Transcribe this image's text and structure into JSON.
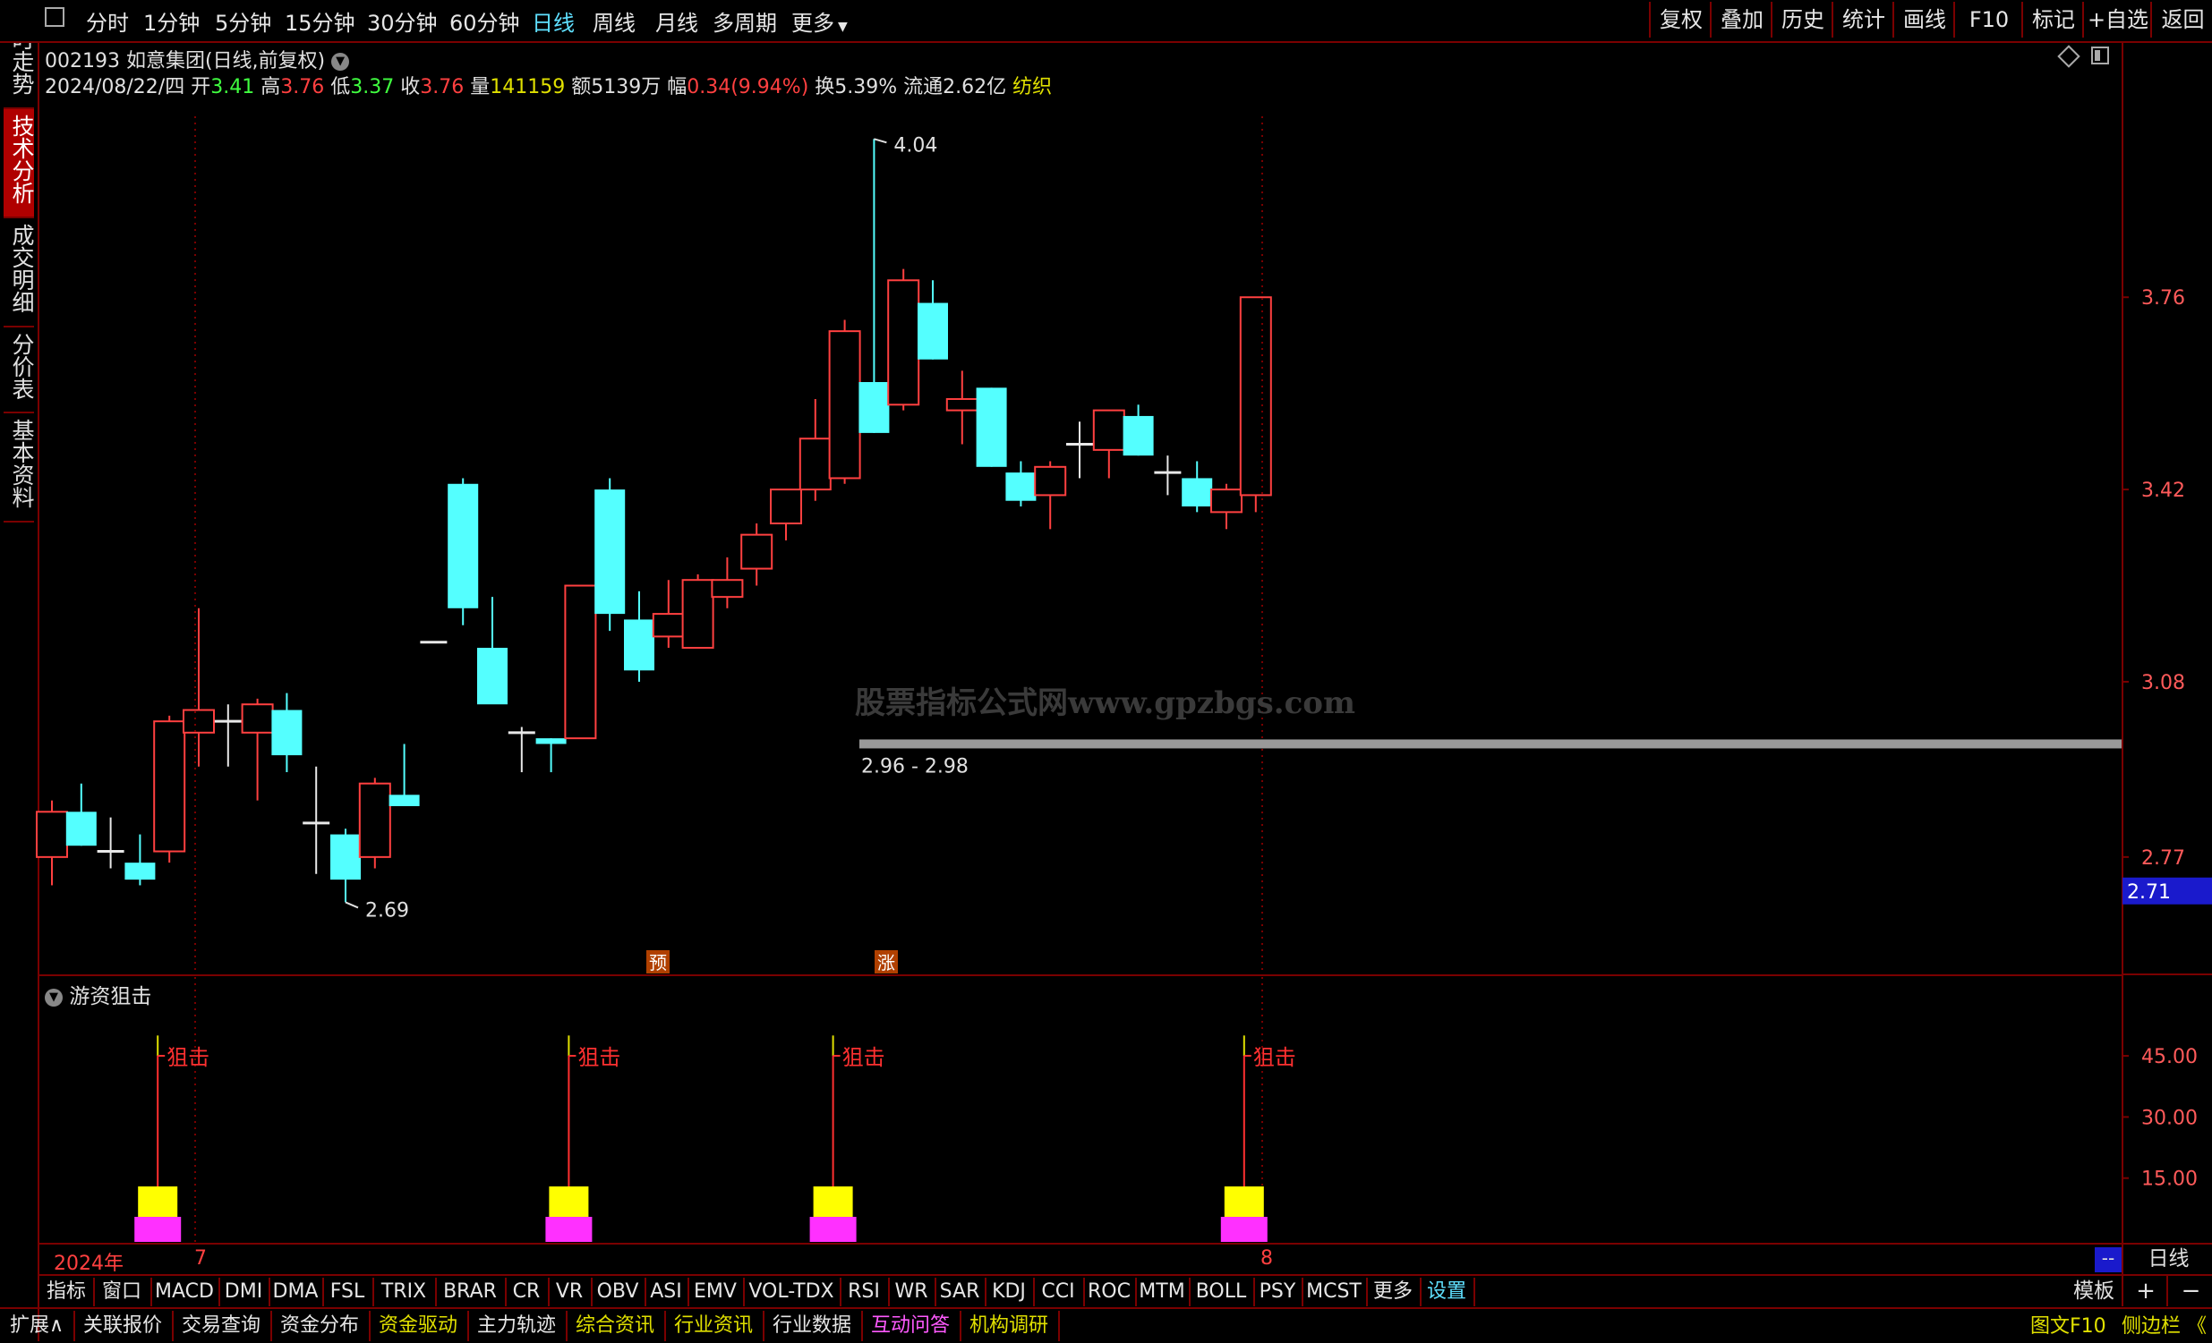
{
  "toolbar": {
    "periods": [
      "分时",
      "1分钟",
      "5分钟",
      "15分钟",
      "30分钟",
      "60分钟",
      "日线",
      "周线",
      "月线",
      "多周期",
      "更多"
    ],
    "active_period": "日线",
    "right_buttons": [
      "复权",
      "叠加",
      "历史",
      "统计",
      "画线",
      "F10",
      "标记",
      "+自选",
      "返回"
    ]
  },
  "left_tabs": [
    "分时走势",
    "技术分析",
    "成交明细",
    "分价表",
    "基本资料"
  ],
  "stock": {
    "code_name": "002193 如意集团(日线,前复权)",
    "date": "2024/08/22/四",
    "open_label": "开",
    "open": "3.41",
    "high_label": "高",
    "high": "3.76",
    "low_label": "低",
    "low": "3.37",
    "close_label": "收",
    "close": "3.76",
    "vol_label": "量",
    "vol": "141159",
    "amount": "额5139万",
    "change_label": "幅",
    "change": "0.34(9.94%)",
    "turnover": "换5.39%",
    "float": "流通2.62亿",
    "industry": "纺织"
  },
  "chart_data": [
    {
      "type": "candlestick",
      "ylim": [
        2.64,
        4.08
      ],
      "y_ticks": [
        "3.76",
        "3.42",
        "3.08",
        "2.77"
      ],
      "current_price_tag": "2.71",
      "candles": [
        {
          "o": 2.77,
          "h": 2.87,
          "l": 2.72,
          "c": 2.85
        },
        {
          "o": 2.85,
          "h": 2.9,
          "l": 2.79,
          "c": 2.79
        },
        {
          "o": 2.78,
          "h": 2.84,
          "l": 2.75,
          "c": 2.78
        },
        {
          "o": 2.76,
          "h": 2.81,
          "l": 2.72,
          "c": 2.73
        },
        {
          "o": 2.78,
          "h": 3.02,
          "l": 2.76,
          "c": 3.01
        },
        {
          "o": 2.99,
          "h": 3.21,
          "l": 2.93,
          "c": 3.03
        },
        {
          "o": 3.01,
          "h": 3.04,
          "l": 2.93,
          "c": 3.01
        },
        {
          "o": 2.99,
          "h": 3.05,
          "l": 2.87,
          "c": 3.04
        },
        {
          "o": 3.03,
          "h": 3.06,
          "l": 2.92,
          "c": 2.95
        },
        {
          "o": 2.83,
          "h": 2.93,
          "l": 2.74,
          "c": 2.83
        },
        {
          "o": 2.81,
          "h": 2.82,
          "l": 2.69,
          "c": 2.73
        },
        {
          "o": 2.77,
          "h": 2.91,
          "l": 2.75,
          "c": 2.9
        },
        {
          "o": 2.88,
          "h": 2.97,
          "l": 2.86,
          "c": 2.86
        },
        {
          "o": 3.15,
          "h": 3.15,
          "l": 3.15,
          "c": 3.15
        },
        {
          "o": 3.43,
          "h": 3.44,
          "l": 3.18,
          "c": 3.21
        },
        {
          "o": 3.14,
          "h": 3.23,
          "l": 3.07,
          "c": 3.04
        },
        {
          "o": 2.99,
          "h": 3.0,
          "l": 2.92,
          "c": 2.99
        },
        {
          "o": 2.98,
          "h": 2.98,
          "l": 2.92,
          "c": 2.97
        },
        {
          "o": 2.98,
          "h": 3.25,
          "l": 2.98,
          "c": 3.25
        },
        {
          "o": 3.42,
          "h": 3.44,
          "l": 3.17,
          "c": 3.2
        },
        {
          "o": 3.19,
          "h": 3.24,
          "l": 3.08,
          "c": 3.1
        },
        {
          "o": 3.16,
          "h": 3.26,
          "l": 3.14,
          "c": 3.2
        },
        {
          "o": 3.14,
          "h": 3.27,
          "l": 3.14,
          "c": 3.26
        },
        {
          "o": 3.23,
          "h": 3.3,
          "l": 3.21,
          "c": 3.26
        },
        {
          "o": 3.28,
          "h": 3.36,
          "l": 3.25,
          "c": 3.34
        },
        {
          "o": 3.36,
          "h": 3.42,
          "l": 3.33,
          "c": 3.42
        },
        {
          "o": 3.42,
          "h": 3.58,
          "l": 3.4,
          "c": 3.51
        },
        {
          "o": 3.44,
          "h": 3.72,
          "l": 3.43,
          "c": 3.7
        },
        {
          "o": 3.61,
          "h": 4.04,
          "l": 3.52,
          "c": 3.52
        },
        {
          "o": 3.57,
          "h": 3.81,
          "l": 3.56,
          "c": 3.79
        },
        {
          "o": 3.75,
          "h": 3.79,
          "l": 3.65,
          "c": 3.65
        },
        {
          "o": 3.56,
          "h": 3.63,
          "l": 3.5,
          "c": 3.58
        },
        {
          "o": 3.6,
          "h": 3.6,
          "l": 3.46,
          "c": 3.46
        },
        {
          "o": 3.45,
          "h": 3.47,
          "l": 3.39,
          "c": 3.4
        },
        {
          "o": 3.41,
          "h": 3.47,
          "l": 3.35,
          "c": 3.46
        },
        {
          "o": 3.5,
          "h": 3.54,
          "l": 3.44,
          "c": 3.5
        },
        {
          "o": 3.49,
          "h": 3.56,
          "l": 3.44,
          "c": 3.56
        },
        {
          "o": 3.55,
          "h": 3.57,
          "l": 3.48,
          "c": 3.48
        },
        {
          "o": 3.45,
          "h": 3.48,
          "l": 3.41,
          "c": 3.45
        },
        {
          "o": 3.44,
          "h": 3.47,
          "l": 3.38,
          "c": 3.39
        },
        {
          "o": 3.38,
          "h": 3.43,
          "l": 3.35,
          "c": 3.42
        },
        {
          "o": 3.41,
          "h": 3.76,
          "l": 3.38,
          "c": 3.76
        }
      ],
      "annotations": {
        "high_marker": "4.04",
        "low_marker": "2.69",
        "range_label": "2.96 - 2.98",
        "badge_pre": "预",
        "badge_up": "涨",
        "watermark": "股票指标公式网www.gpzbgs.com"
      }
    },
    {
      "type": "bar",
      "title": "游资狙击",
      "ylim": [
        0,
        56
      ],
      "y_ticks": [
        "45.00",
        "30.00",
        "15.00"
      ],
      "signal_label": "狙击",
      "signal_candle_index": [
        4,
        18,
        27,
        41
      ],
      "signal_values": [
        50,
        50,
        50,
        50
      ]
    }
  ],
  "timeline": {
    "year": "2024年",
    "m1": "7",
    "m2": "8",
    "corner": "--",
    "period": "日线"
  },
  "indicator_tabs": [
    "指标",
    "窗口",
    "MACD",
    "DMI",
    "DMA",
    "FSL",
    "TRIX",
    "BRAR",
    "CR",
    "VR",
    "OBV",
    "ASI",
    "EMV",
    "VOL-TDX",
    "RSI",
    "WR",
    "SAR",
    "KDJ",
    "CCI",
    "ROC",
    "MTM",
    "BOLL",
    "PSY",
    "MCST",
    "更多",
    "设置"
  ],
  "indicator_right": {
    "template": "模板",
    "plus": "+",
    "minus": "−"
  },
  "bottom_tabs": [
    "扩展∧",
    "关联报价",
    "交易查询",
    "资金分布",
    "资金驱动",
    "主力轨迹",
    "综合资讯",
    "行业资讯",
    "行业数据",
    "互动问答",
    "机构调研"
  ],
  "bottom_right": {
    "f10": "图文F10",
    "sidebar": "侧边栏 《"
  },
  "colors": {
    "up": "#ff4040",
    "down": "#54ffff",
    "axis_red": "#7a0000",
    "active": "#5fe0ff"
  }
}
